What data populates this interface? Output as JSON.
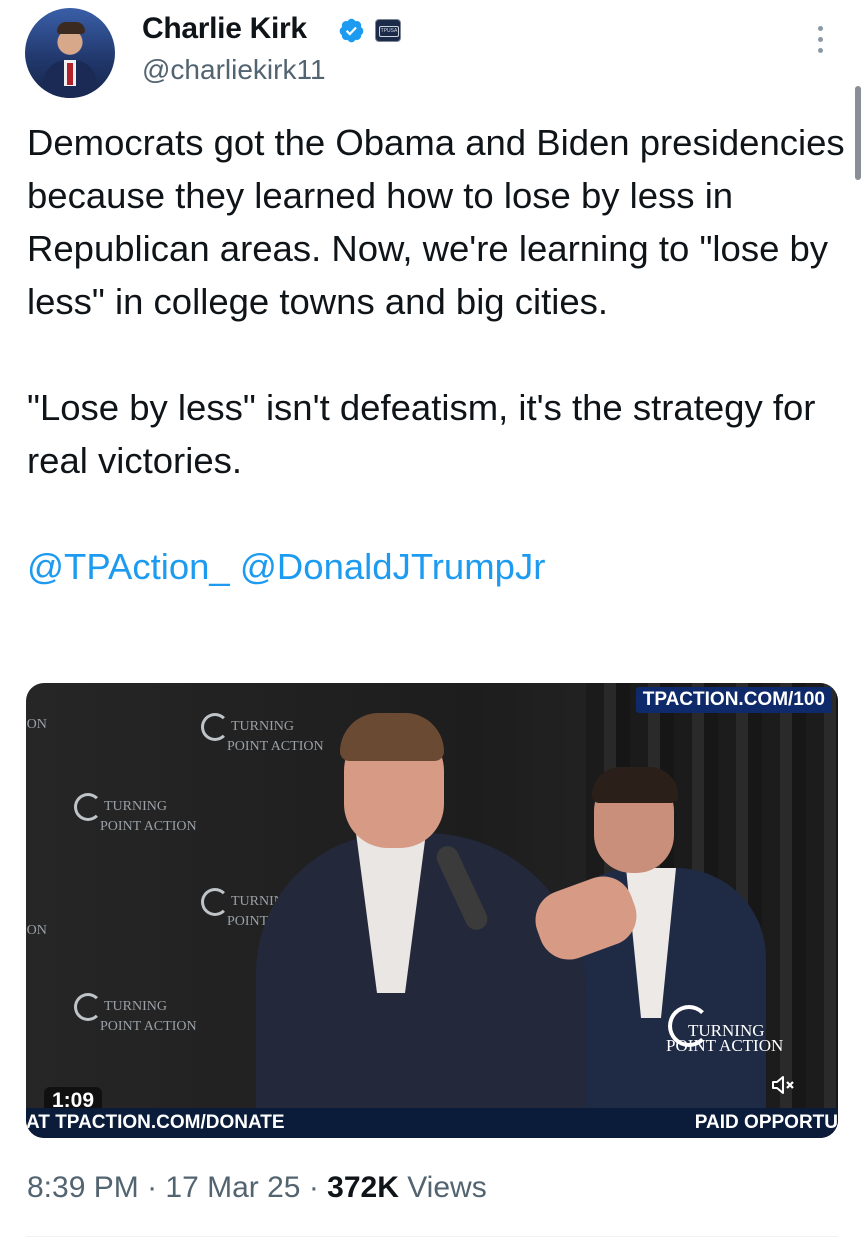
{
  "author": {
    "name": "Charlie Kirk",
    "handle": "@charliekirk11",
    "affiliate_badge_text": "TPUSA",
    "verified_color": "#1d9bf0"
  },
  "tweet": {
    "paragraph1": "Democrats got the Obama and Biden presidencies because they learned how to lose by less in Republican areas. Now, we're learning to \"lose by less\" in college towns and big cities.",
    "paragraph2": "\"Lose by less\" isn't defeatism, it's the strategy for real victories.",
    "mentions": "@TPAction_ @DonaldJTrumpJr"
  },
  "video": {
    "corner_tag": "TPACTION.COM/100",
    "watermark_line1": "TURNING",
    "watermark_line2": "POINT ACTION",
    "duration": "1:09",
    "ticker_left": "AT TPACTION.COM/DONATE",
    "ticker_right": "PAID OPPORTU",
    "mute_icon": "speaker-muted-icon",
    "backdrop_logos": [
      {
        "line1": "TURNING",
        "line2": "POINT ACTION"
      },
      {
        "line1": "TURNING",
        "line2": "POINT ACTION"
      },
      {
        "line1": "TURNING",
        "line2": "POINT"
      },
      {
        "line1": "TURNING",
        "line2": "POINT ACTION"
      }
    ],
    "edge_text_top": "ION",
    "edge_text_bottom": "ION"
  },
  "meta": {
    "time": "8:39 PM",
    "date": "17 Mar 25",
    "views_count": "372K",
    "views_label": "Views"
  }
}
